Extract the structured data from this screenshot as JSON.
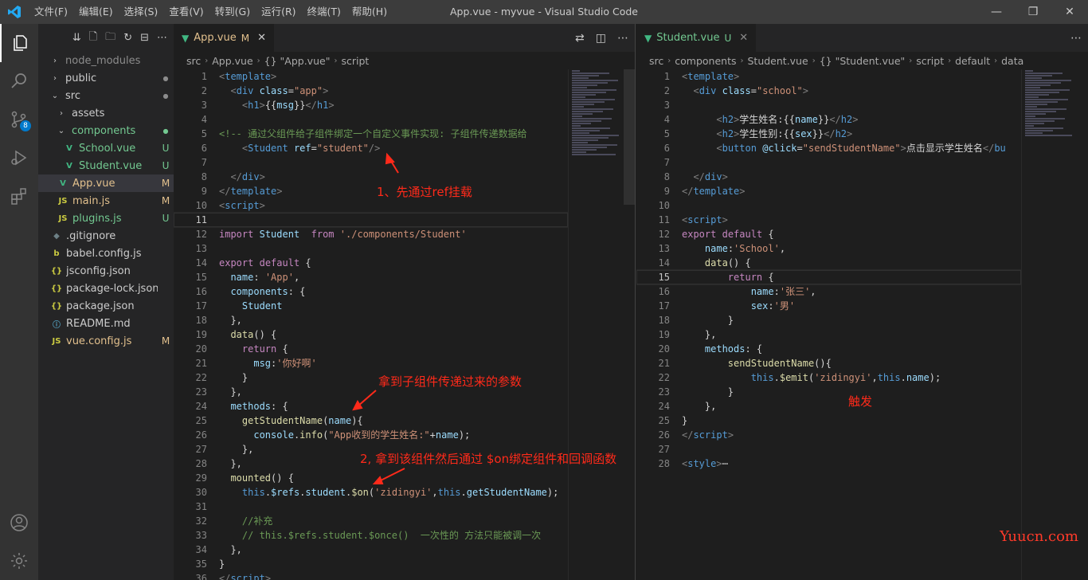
{
  "title_bar": {
    "menus": [
      "文件(F)",
      "编辑(E)",
      "选择(S)",
      "查看(V)",
      "转到(G)",
      "运行(R)",
      "终端(T)",
      "帮助(H)"
    ],
    "window_title": "App.vue - myvue - Visual Studio Code",
    "controls": [
      "—",
      "❐",
      "✕"
    ]
  },
  "activity_bar": {
    "scm_badge": "8",
    "icons": [
      "explorer-icon",
      "search-icon",
      "source-control-icon",
      "run-debug-icon",
      "extensions-icon",
      "account-icon",
      "settings-gear-icon"
    ]
  },
  "explorer": {
    "items": [
      {
        "depth": 0,
        "chev": "›",
        "name": "node_modules",
        "color": "#8c8c8c",
        "deco": ""
      },
      {
        "depth": 0,
        "chev": "›",
        "name": "public",
        "color": "#cccccc",
        "deco": "●",
        "deco_color": "#8c8c8c"
      },
      {
        "depth": 0,
        "chev": "⌄",
        "name": "src",
        "color": "#cccccc",
        "deco": "●",
        "deco_color": "#8c8c8c"
      },
      {
        "depth": 1,
        "chev": "›",
        "name": "assets",
        "color": "#cccccc",
        "deco": ""
      },
      {
        "depth": 1,
        "chev": "⌄",
        "name": "components",
        "color": "#73c991",
        "deco": "●",
        "deco_color": "#73c991"
      },
      {
        "depth": 2,
        "icon": "V",
        "icon_color": "#41b883",
        "name": "School.vue",
        "color": "#73c991",
        "deco": "U",
        "deco_color": "#73c991"
      },
      {
        "depth": 2,
        "icon": "V",
        "icon_color": "#41b883",
        "name": "Student.vue",
        "color": "#73c991",
        "deco": "U",
        "deco_color": "#73c991"
      },
      {
        "depth": 1,
        "icon": "V",
        "icon_color": "#41b883",
        "name": "App.vue",
        "color": "#e2c08d",
        "deco": "M",
        "deco_color": "#e2c08d",
        "selected": true
      },
      {
        "depth": 1,
        "icon": "JS",
        "icon_color": "#cbcb41",
        "name": "main.js",
        "color": "#e2c08d",
        "deco": "M",
        "deco_color": "#e2c08d"
      },
      {
        "depth": 1,
        "icon": "JS",
        "icon_color": "#cbcb41",
        "name": "plugins.js",
        "color": "#73c991",
        "deco": "U",
        "deco_color": "#73c991"
      },
      {
        "depth": 0,
        "icon": "◆",
        "icon_color": "#6d8086",
        "name": ".gitignore",
        "color": "#cccccc",
        "deco": ""
      },
      {
        "depth": 0,
        "icon": "b",
        "icon_color": "#cbcb41",
        "name": "babel.config.js",
        "color": "#cccccc",
        "deco": ""
      },
      {
        "depth": 0,
        "icon": "{}",
        "icon_color": "#cbcb41",
        "name": "jsconfig.json",
        "color": "#cccccc",
        "deco": ""
      },
      {
        "depth": 0,
        "icon": "{}",
        "icon_color": "#cbcb41",
        "name": "package-lock.json",
        "color": "#cccccc",
        "deco": ""
      },
      {
        "depth": 0,
        "icon": "{}",
        "icon_color": "#cbcb41",
        "name": "package.json",
        "color": "#cccccc",
        "deco": ""
      },
      {
        "depth": 0,
        "icon": "ⓘ",
        "icon_color": "#519aba",
        "name": "README.md",
        "color": "#cccccc",
        "deco": ""
      },
      {
        "depth": 0,
        "icon": "JS",
        "icon_color": "#cbcb41",
        "name": "vue.config.js",
        "color": "#e2c08d",
        "deco": "M",
        "deco_color": "#e2c08d"
      }
    ]
  },
  "left_editor": {
    "tab": {
      "name": "App.vue",
      "mark": "M",
      "close": "✕"
    },
    "breadcrumbs": [
      "src",
      "App.vue",
      "{} \"App.vue\"",
      "script"
    ],
    "current_line": 11,
    "lines": [
      [
        [
          "t-tag",
          "<"
        ],
        [
          "t-tn",
          "template"
        ],
        [
          "t-tag",
          ">"
        ]
      ],
      [
        [
          "t-plain",
          "  "
        ],
        [
          "t-tag",
          "<"
        ],
        [
          "t-tn",
          "div"
        ],
        [
          "t-plain",
          " "
        ],
        [
          "t-attr",
          "class"
        ],
        [
          "t-plain",
          "="
        ],
        [
          "t-str",
          "\"app\""
        ],
        [
          "t-tag",
          ">"
        ]
      ],
      [
        [
          "t-plain",
          "    "
        ],
        [
          "t-tag",
          "<"
        ],
        [
          "t-tn",
          "h1"
        ],
        [
          "t-tag",
          ">"
        ],
        [
          "t-plain",
          "{{"
        ],
        [
          "t-var",
          "msg"
        ],
        [
          "t-plain",
          "}}"
        ],
        [
          "t-tag",
          "</"
        ],
        [
          "t-tn",
          "h1"
        ],
        [
          "t-tag",
          ">"
        ]
      ],
      [],
      [
        [
          "t-cmt",
          "<!-- 通过父组件给子组件绑定一个自定义事件实现: 子组件传递数据给"
        ]
      ],
      [
        [
          "t-plain",
          "    "
        ],
        [
          "t-tag",
          "<"
        ],
        [
          "t-tn",
          "Student"
        ],
        [
          "t-plain",
          " "
        ],
        [
          "t-attr",
          "ref"
        ],
        [
          "t-plain",
          "="
        ],
        [
          "t-str",
          "\"student\""
        ],
        [
          "t-tag",
          "/>"
        ]
      ],
      [],
      [
        [
          "t-plain",
          "  "
        ],
        [
          "t-tag",
          "</"
        ],
        [
          "t-tn",
          "div"
        ],
        [
          "t-tag",
          ">"
        ]
      ],
      [
        [
          "t-tag",
          "</"
        ],
        [
          "t-tn",
          "template"
        ],
        [
          "t-tag",
          ">"
        ]
      ],
      [
        [
          "t-tag",
          "<"
        ],
        [
          "t-tn",
          "script"
        ],
        [
          "t-tag",
          ">"
        ]
      ],
      [],
      [
        [
          "t-kw",
          "import"
        ],
        [
          "t-plain",
          " "
        ],
        [
          "t-var",
          "Student"
        ],
        [
          "t-plain",
          "  "
        ],
        [
          "t-kw",
          "from"
        ],
        [
          "t-plain",
          " "
        ],
        [
          "t-str",
          "'./components/Student'"
        ]
      ],
      [],
      [
        [
          "t-kw",
          "export"
        ],
        [
          "t-plain",
          " "
        ],
        [
          "t-kw",
          "default"
        ],
        [
          "t-plain",
          " {"
        ]
      ],
      [
        [
          "t-plain",
          "  "
        ],
        [
          "t-var",
          "name"
        ],
        [
          "t-plain",
          ": "
        ],
        [
          "t-str",
          "'App'"
        ],
        [
          "t-plain",
          ","
        ]
      ],
      [
        [
          "t-plain",
          "  "
        ],
        [
          "t-var",
          "components"
        ],
        [
          "t-plain",
          ": {"
        ]
      ],
      [
        [
          "t-plain",
          "    "
        ],
        [
          "t-var",
          "Student"
        ]
      ],
      [
        [
          "t-plain",
          "  },"
        ]
      ],
      [
        [
          "t-plain",
          "  "
        ],
        [
          "t-fn",
          "data"
        ],
        [
          "t-plain",
          "() {"
        ]
      ],
      [
        [
          "t-plain",
          "    "
        ],
        [
          "t-kw",
          "return"
        ],
        [
          "t-plain",
          " {"
        ]
      ],
      [
        [
          "t-plain",
          "      "
        ],
        [
          "t-var",
          "msg"
        ],
        [
          "t-plain",
          ":"
        ],
        [
          "t-str",
          "'你好啊'"
        ]
      ],
      [
        [
          "t-plain",
          "    }"
        ]
      ],
      [
        [
          "t-plain",
          "  },"
        ]
      ],
      [
        [
          "t-plain",
          "  "
        ],
        [
          "t-var",
          "methods"
        ],
        [
          "t-plain",
          ": {"
        ]
      ],
      [
        [
          "t-plain",
          "    "
        ],
        [
          "t-fn",
          "getStudentName"
        ],
        [
          "t-plain",
          "("
        ],
        [
          "t-var",
          "name"
        ],
        [
          "t-plain",
          "){"
        ]
      ],
      [
        [
          "t-plain",
          "      "
        ],
        [
          "t-var",
          "console"
        ],
        [
          "t-plain",
          "."
        ],
        [
          "t-fn",
          "info"
        ],
        [
          "t-plain",
          "("
        ],
        [
          "t-str",
          "\"App收到的学生姓名:\""
        ],
        [
          "t-plain",
          "+"
        ],
        [
          "t-var",
          "name"
        ],
        [
          "t-plain",
          ");"
        ]
      ],
      [
        [
          "t-plain",
          "    },"
        ]
      ],
      [
        [
          "t-plain",
          "  },"
        ]
      ],
      [
        [
          "t-plain",
          "  "
        ],
        [
          "t-fn",
          "mounted"
        ],
        [
          "t-plain",
          "() {"
        ]
      ],
      [
        [
          "t-plain",
          "    "
        ],
        [
          "t-blue",
          "this"
        ],
        [
          "t-plain",
          "."
        ],
        [
          "t-var",
          "$refs"
        ],
        [
          "t-plain",
          "."
        ],
        [
          "t-var",
          "student"
        ],
        [
          "t-plain",
          "."
        ],
        [
          "t-fn",
          "$on"
        ],
        [
          "t-plain",
          "("
        ],
        [
          "t-str",
          "'zidingyi'"
        ],
        [
          "t-plain",
          ","
        ],
        [
          "t-blue",
          "this"
        ],
        [
          "t-plain",
          "."
        ],
        [
          "t-var",
          "getStudentName"
        ],
        [
          "t-plain",
          ");"
        ]
      ],
      [],
      [
        [
          "t-plain",
          "    "
        ],
        [
          "t-cmt",
          "//补充"
        ]
      ],
      [
        [
          "t-plain",
          "    "
        ],
        [
          "t-cmt",
          "// this.$refs.student.$once()  一次性的 方法只能被调一次"
        ]
      ],
      [
        [
          "t-plain",
          "  },"
        ]
      ],
      [
        [
          "t-plain",
          "}"
        ]
      ],
      [
        [
          "t-tag",
          "</"
        ],
        [
          "t-tn",
          "script"
        ],
        [
          "t-tag",
          ">"
        ]
      ]
    ]
  },
  "right_editor": {
    "tab": {
      "name": "Student.vue",
      "mark": "U",
      "close": "✕"
    },
    "breadcrumbs": [
      "src",
      "components",
      "Student.vue",
      "{} \"Student.vue\"",
      "script",
      "default",
      "data"
    ],
    "current_line": 15,
    "lines": [
      [
        [
          "t-tag",
          "<"
        ],
        [
          "t-tn",
          "template"
        ],
        [
          "t-tag",
          ">"
        ]
      ],
      [
        [
          "t-plain",
          "  "
        ],
        [
          "t-tag",
          "<"
        ],
        [
          "t-tn",
          "div"
        ],
        [
          "t-plain",
          " "
        ],
        [
          "t-attr",
          "class"
        ],
        [
          "t-plain",
          "="
        ],
        [
          "t-str",
          "\"school\""
        ],
        [
          "t-tag",
          ">"
        ]
      ],
      [],
      [
        [
          "t-plain",
          "      "
        ],
        [
          "t-tag",
          "<"
        ],
        [
          "t-tn",
          "h2"
        ],
        [
          "t-tag",
          ">"
        ],
        [
          "t-plain",
          "学生姓名:{{"
        ],
        [
          "t-var",
          "name"
        ],
        [
          "t-plain",
          "}}"
        ],
        [
          "t-tag",
          "</"
        ],
        [
          "t-tn",
          "h2"
        ],
        [
          "t-tag",
          ">"
        ]
      ],
      [
        [
          "t-plain",
          "      "
        ],
        [
          "t-tag",
          "<"
        ],
        [
          "t-tn",
          "h2"
        ],
        [
          "t-tag",
          ">"
        ],
        [
          "t-plain",
          "学生性别:{{"
        ],
        [
          "t-var",
          "sex"
        ],
        [
          "t-plain",
          "}}"
        ],
        [
          "t-tag",
          "</"
        ],
        [
          "t-tn",
          "h2"
        ],
        [
          "t-tag",
          ">"
        ]
      ],
      [
        [
          "t-plain",
          "      "
        ],
        [
          "t-tag",
          "<"
        ],
        [
          "t-tn",
          "button"
        ],
        [
          "t-plain",
          " "
        ],
        [
          "t-attr",
          "@click"
        ],
        [
          "t-plain",
          "="
        ],
        [
          "t-str",
          "\"sendStudentName\""
        ],
        [
          "t-tag",
          ">"
        ],
        [
          "t-plain",
          "点击显示学生姓名"
        ],
        [
          "t-tag",
          "</"
        ],
        [
          "t-tn",
          "bu"
        ]
      ],
      [],
      [
        [
          "t-plain",
          "  "
        ],
        [
          "t-tag",
          "</"
        ],
        [
          "t-tn",
          "div"
        ],
        [
          "t-tag",
          ">"
        ]
      ],
      [
        [
          "t-tag",
          "</"
        ],
        [
          "t-tn",
          "template"
        ],
        [
          "t-tag",
          ">"
        ]
      ],
      [],
      [
        [
          "t-tag",
          "<"
        ],
        [
          "t-tn",
          "script"
        ],
        [
          "t-tag",
          ">"
        ]
      ],
      [
        [
          "t-kw",
          "export"
        ],
        [
          "t-plain",
          " "
        ],
        [
          "t-kw",
          "default"
        ],
        [
          "t-plain",
          " {"
        ]
      ],
      [
        [
          "t-plain",
          "    "
        ],
        [
          "t-var",
          "name"
        ],
        [
          "t-plain",
          ":"
        ],
        [
          "t-str",
          "'School'"
        ],
        [
          "t-plain",
          ","
        ]
      ],
      [
        [
          "t-plain",
          "    "
        ],
        [
          "t-fn",
          "data"
        ],
        [
          "t-plain",
          "() {"
        ]
      ],
      [
        [
          "t-plain",
          "        "
        ],
        [
          "t-kw",
          "return"
        ],
        [
          "t-plain",
          " {"
        ]
      ],
      [
        [
          "t-plain",
          "            "
        ],
        [
          "t-var",
          "name"
        ],
        [
          "t-plain",
          ":"
        ],
        [
          "t-str",
          "'张三'"
        ],
        [
          "t-plain",
          ","
        ]
      ],
      [
        [
          "t-plain",
          "            "
        ],
        [
          "t-var",
          "sex"
        ],
        [
          "t-plain",
          ":"
        ],
        [
          "t-str",
          "'男'"
        ]
      ],
      [
        [
          "t-plain",
          "        }"
        ]
      ],
      [
        [
          "t-plain",
          "    },"
        ]
      ],
      [
        [
          "t-plain",
          "    "
        ],
        [
          "t-var",
          "methods"
        ],
        [
          "t-plain",
          ": {"
        ]
      ],
      [
        [
          "t-plain",
          "        "
        ],
        [
          "t-fn",
          "sendStudentName"
        ],
        [
          "t-plain",
          "(){"
        ]
      ],
      [
        [
          "t-plain",
          "            "
        ],
        [
          "t-blue",
          "this"
        ],
        [
          "t-plain",
          "."
        ],
        [
          "t-fn",
          "$emit"
        ],
        [
          "t-plain",
          "("
        ],
        [
          "t-str",
          "'zidingyi'"
        ],
        [
          "t-plain",
          ","
        ],
        [
          "t-blue",
          "this"
        ],
        [
          "t-plain",
          "."
        ],
        [
          "t-var",
          "name"
        ],
        [
          "t-plain",
          ");"
        ]
      ],
      [
        [
          "t-plain",
          "        }"
        ]
      ],
      [
        [
          "t-plain",
          "    },"
        ]
      ],
      [
        [
          "t-plain",
          "}"
        ]
      ],
      [
        [
          "t-tag",
          "</"
        ],
        [
          "t-tn",
          "script"
        ],
        [
          "t-tag",
          ">"
        ]
      ],
      [],
      [
        [
          "t-tag",
          "<"
        ],
        [
          "t-tn",
          "style"
        ],
        [
          "t-tag",
          ">"
        ],
        [
          "t-plain",
          "⋯"
        ]
      ]
    ]
  },
  "annotations": {
    "a1": "1、先通过ref挂载",
    "a2": "拿到子组件传递过来的参数",
    "a3": "2, 拿到该组件然后通过 $on绑定组件和回调函数",
    "a4": "触发"
  },
  "watermark": "Yuucn.com",
  "colors": {
    "accent": "#007acc",
    "annotation": "#ff2a1a",
    "vue_green": "#41b883"
  }
}
